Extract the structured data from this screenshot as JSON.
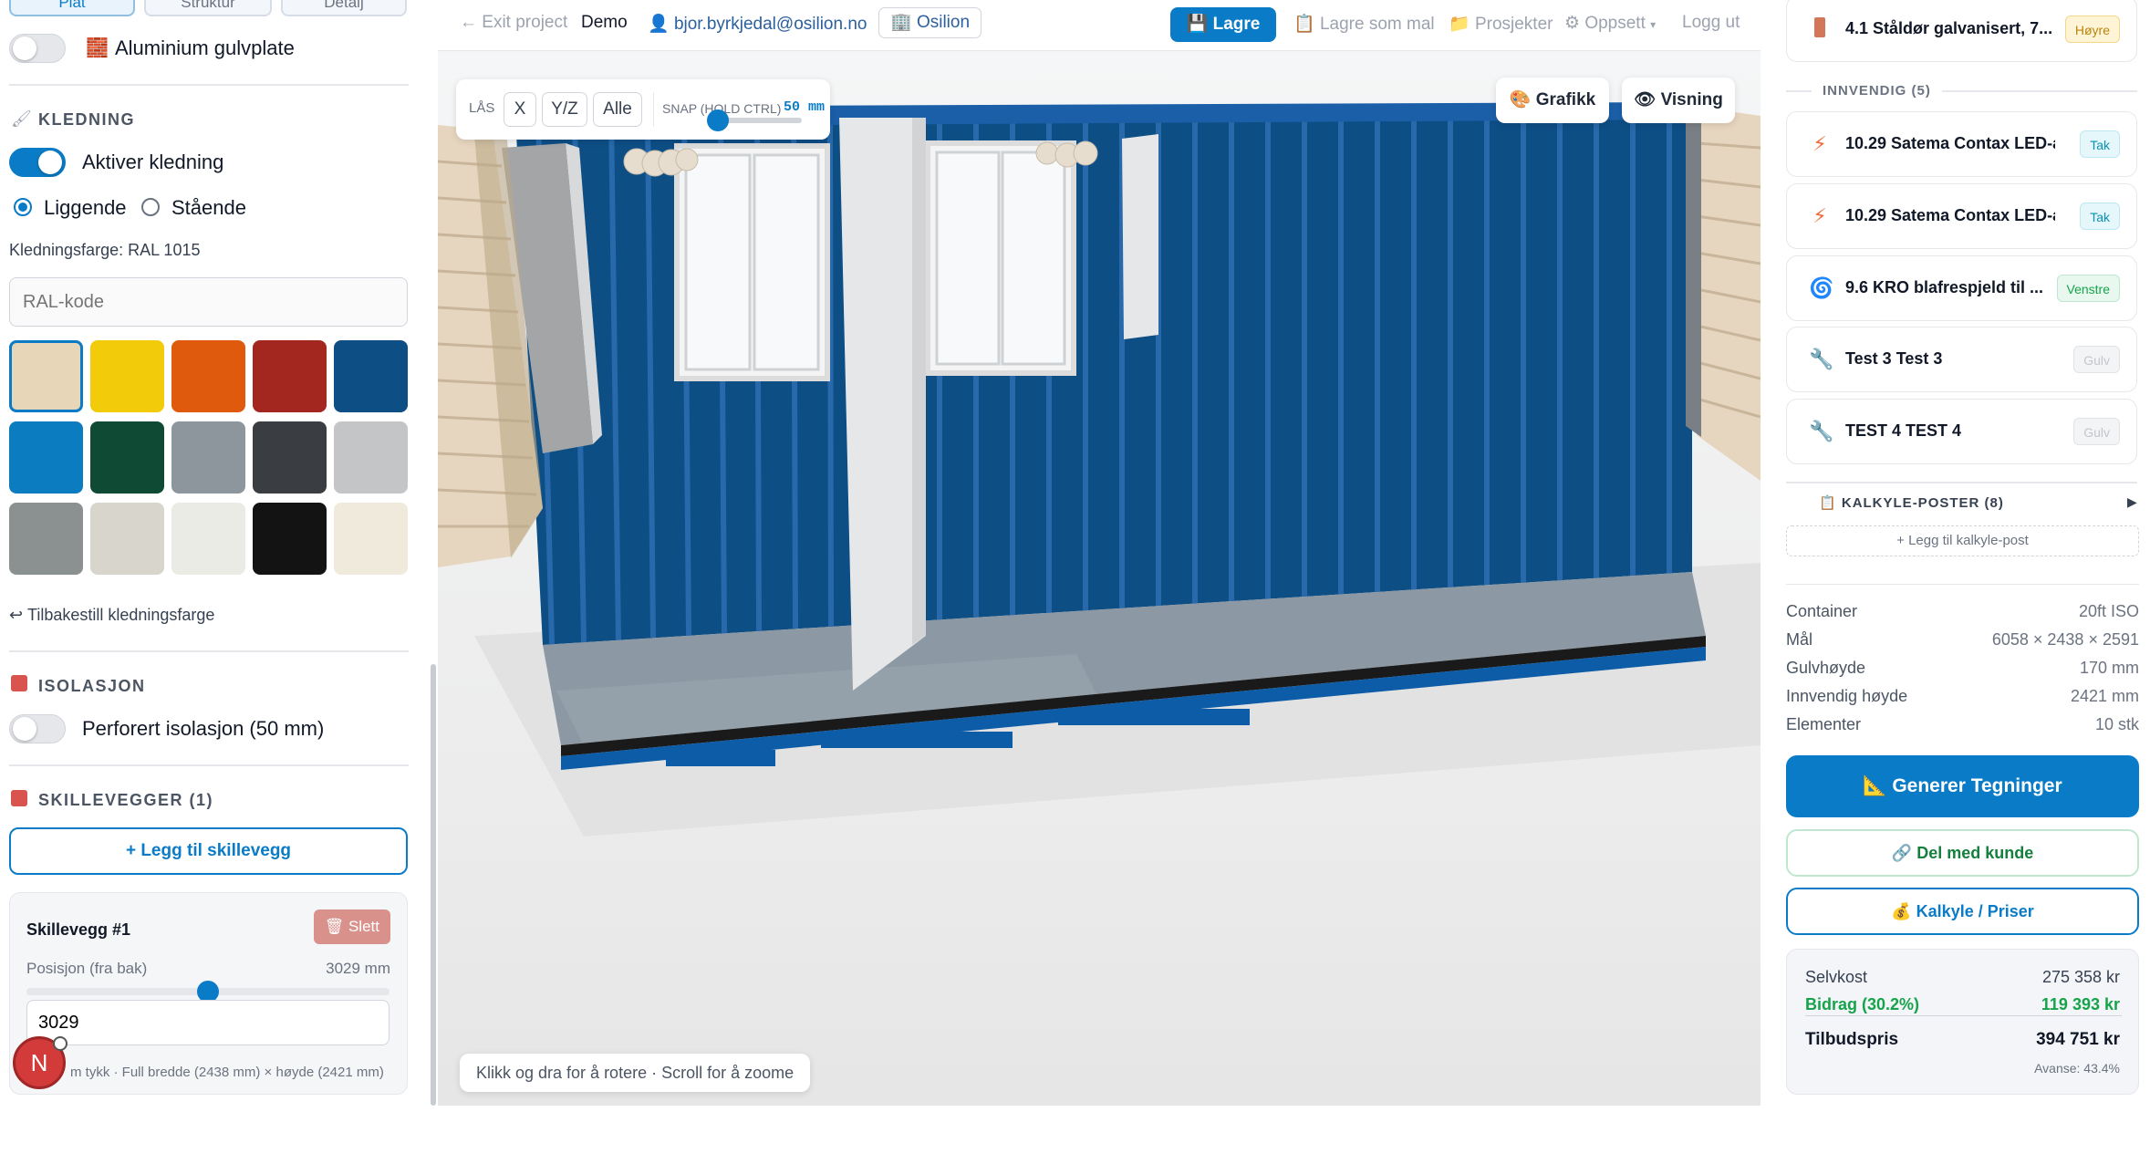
{
  "left": {
    "tabs": [
      "Plat",
      "Struktur",
      "Detalj"
    ],
    "floor_item": {
      "label": "Aluminium gulvplate",
      "enabled": false
    },
    "kledning": {
      "heading": "KLEDNING",
      "toggle_label": "Aktiver kledning",
      "enabled": true,
      "orientation": [
        {
          "label": "Liggende",
          "selected": true
        },
        {
          "label": "Stående",
          "selected": false
        }
      ],
      "color_label": "Kledningsfarge: RAL 1015",
      "ral_placeholder": "RAL-kode",
      "swatches": [
        "#e8d6b9",
        "#f2cb0a",
        "#e05a0d",
        "#a3271f",
        "#0d4e85",
        "#0c7cc0",
        "#0f4a34",
        "#8e969d",
        "#3a3d41",
        "#c4c5c6",
        "#8b9091",
        "#d8d5cd",
        "#ebebe6",
        "#131313",
        "#efeadb"
      ],
      "selected_swatch": 0,
      "reset_label": "Tilbakestill kledningsfarge"
    },
    "isolasjon": {
      "heading": "ISOLASJON",
      "toggle_label": "Perforert isolasjon (50 mm)",
      "enabled": false
    },
    "skillevegger": {
      "heading": "SKILLEVEGGER (1)",
      "add_label": "+ Legg til skillevegg",
      "item": {
        "title": "Skillevegg #1",
        "delete_label": "Slett",
        "pos_label": "Posisjon (fra bak)",
        "pos_value": "3029 mm",
        "pos_fraction": 0.5,
        "input_value": "3029",
        "note": "m tykk · Full bredde (2438 mm) × høyde (2421 mm)"
      }
    },
    "avatar": "N"
  },
  "topbar": {
    "exit": "Exit project",
    "project": "Demo",
    "user": "bjor.byrkjedal@osilion.no",
    "org": "Osilion",
    "save": "Lagre",
    "save_template": "Lagre som mal",
    "projects": "Prosjekter",
    "setup": "Oppsett",
    "logout": "Logg ut"
  },
  "viewport": {
    "lock_label": "LÅS",
    "lock_buttons": [
      "X",
      "Y/Z",
      "Alle"
    ],
    "snap_label": "SNAP (HOLD CTRL)",
    "snap_value": "50 mm",
    "snap_fraction": 0.12,
    "graphics_btn": "Grafikk",
    "view_btn": "Visning",
    "hint": "Klikk og dra for å rotere · Scroll for å zoome"
  },
  "right": {
    "top_item": {
      "title": "4.1 Ståldør galvanisert, 7...",
      "tag": "Høyre"
    },
    "innvendig_heading": "INNVENDIG (5)",
    "items": [
      {
        "title": "10.29 Satema Contax LED-a...",
        "tag": "Tak",
        "icon": "lightning-icon"
      },
      {
        "title": "10.29 Satema Contax LED-a...",
        "tag": "Tak",
        "icon": "lightning-icon"
      },
      {
        "title": "9.6 KRO blafrespjeld til ...",
        "tag": "Venstre",
        "icon": "fan-icon"
      },
      {
        "title": "Test 3 Test 3",
        "tag": "Gulv",
        "icon": "wrench-icon"
      },
      {
        "title": "TEST 4 TEST 4",
        "tag": "Gulv",
        "icon": "wrench-icon"
      }
    ],
    "kalkyle_heading": "KALKYLE-POSTER (8)",
    "add_kalkyle": "+ Legg til kalkyle-post",
    "specs": [
      {
        "label": "Container",
        "value": "20ft ISO"
      },
      {
        "label": "Mål",
        "value": "6058 × 2438 × 2591"
      },
      {
        "label": "Gulvhøyde",
        "value": "170 mm"
      },
      {
        "label": "Innvendig høyde",
        "value": "2421 mm"
      },
      {
        "label": "Elementer",
        "value": "10 stk"
      }
    ],
    "generate_btn": "Generer Tegninger",
    "share_btn": "Del med kunde",
    "calc_btn": "Kalkyle / Priser",
    "summary": {
      "selvkost_label": "Selvkost",
      "selvkost_value": "275 358 kr",
      "bidrag_label": "Bidrag (30.2%)",
      "bidrag_value": "119 393 kr",
      "tilbud_label": "Tilbudspris",
      "tilbud_value": "394 751 kr",
      "avanse": "Avanse: 43.4%"
    }
  }
}
